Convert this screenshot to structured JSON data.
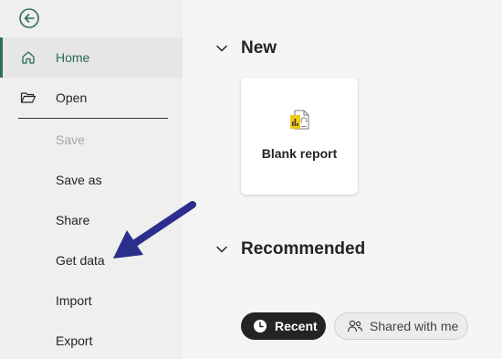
{
  "sidebar": {
    "back_icon": "arrow-left-circle-icon",
    "items": [
      {
        "label": "Home",
        "icon": "home-icon",
        "active": true
      },
      {
        "label": "Open",
        "icon": "folder-open-icon"
      },
      {
        "label": "Save",
        "disabled": true
      },
      {
        "label": "Save as"
      },
      {
        "label": "Share"
      },
      {
        "label": "Get data"
      },
      {
        "label": "Import"
      },
      {
        "label": "Export"
      }
    ]
  },
  "main": {
    "new_section": {
      "title": "New"
    },
    "blank_report": {
      "label": "Blank report",
      "icon": "power-bi-report-icon"
    },
    "recommended_section": {
      "title": "Recommended"
    },
    "filters": {
      "recent": {
        "label": "Recent",
        "icon": "clock-icon"
      },
      "shared": {
        "label": "Shared with me",
        "icon": "people-icon"
      }
    }
  },
  "annotation": {
    "arrow_color": "#2b2e8c",
    "points_to": "Get data"
  },
  "colors": {
    "accent": "#2f6f55",
    "sidebar_bg": "#efefef",
    "main_bg": "#f5f5f5",
    "pill_dark": "#242424"
  }
}
